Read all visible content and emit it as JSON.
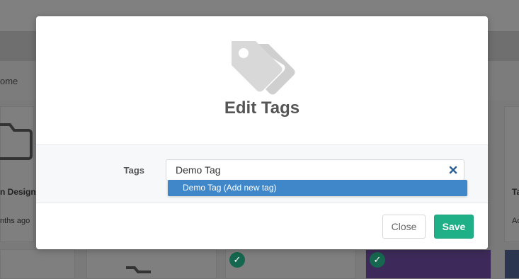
{
  "background": {
    "breadcrumb": "ome",
    "cards": [
      {
        "title": "n Design",
        "meta": "nths ago"
      },
      {
        "title": "Ta",
        "meta": "Ad"
      }
    ]
  },
  "modal": {
    "icon": "tags-icon",
    "title": "Edit Tags",
    "tags_label": "Tags",
    "tags_value": "Demo Tag",
    "suggestion": "Demo Tag (Add new tag)",
    "close_label": "Close",
    "save_label": "Save"
  },
  "colors": {
    "accent": "#20b088",
    "suggest": "#3f87c8"
  }
}
